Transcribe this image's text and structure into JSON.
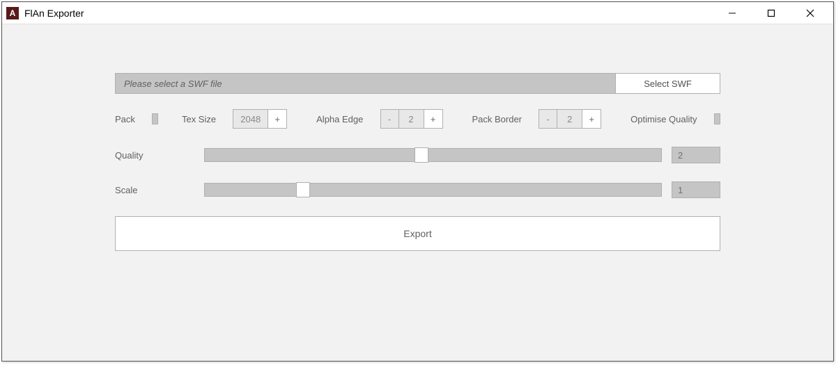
{
  "window": {
    "title": "FlAn Exporter",
    "icon_glyph": "A"
  },
  "file": {
    "placeholder": "Please select a SWF file",
    "select_label": "Select SWF"
  },
  "options": {
    "pack_label": "Pack",
    "tex_size_label": "Tex Size",
    "tex_size_value": "2048",
    "alpha_edge_label": "Alpha Edge",
    "alpha_edge_value": "2",
    "pack_border_label": "Pack Border",
    "pack_border_value": "2",
    "optimise_label": "Optimise Quality",
    "plus": "+",
    "minus": "-"
  },
  "sliders": {
    "quality_label": "Quality",
    "quality_value": "2",
    "quality_thumb_pct": 46,
    "scale_label": "Scale",
    "scale_value": "1",
    "scale_thumb_pct": 20
  },
  "export_label": "Export"
}
